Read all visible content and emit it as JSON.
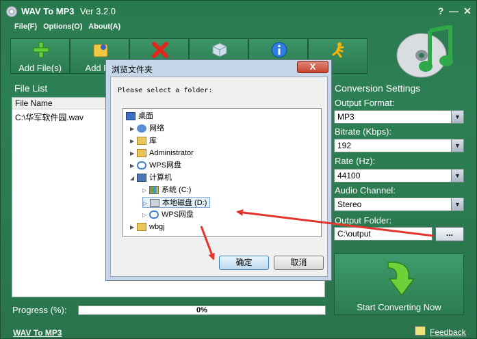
{
  "window": {
    "title": "WAV To MP3",
    "version": "Ver 3.2.0",
    "help_btn": "?",
    "min_btn": "—",
    "close_btn": "✕"
  },
  "menu": [
    "File(F)",
    "Options(O)",
    "About(A)"
  ],
  "toolbar": {
    "add_files": "Add File(s)",
    "add_folder": "Add Fo",
    "exit": "Exit"
  },
  "file_list": {
    "title": "File List",
    "header": "File Name",
    "rows": [
      "C:\\华军软件园.wav"
    ]
  },
  "progress": {
    "label": "Progress (%):",
    "value_text": "0%",
    "value": 0
  },
  "footer": {
    "link": "WAV To MP3",
    "feedback": "Feedback"
  },
  "settings": {
    "title": "Conversion Settings",
    "output_format_label": "Output Format:",
    "output_format_value": "MP3",
    "bitrate_label": "Bitrate (Kbps):",
    "bitrate_value": "192",
    "rate_label": "Rate (Hz):",
    "rate_value": "44100",
    "channel_label": "Audio Channel:",
    "channel_value": "Stereo",
    "folder_label": "Output Folder:",
    "folder_value": "C:\\output",
    "browse_label": "...",
    "start_label": "Start Converting Now"
  },
  "dialog": {
    "title": "浏览文件夹",
    "close": "X",
    "prompt": "Please select a folder:",
    "tree": [
      {
        "label": "桌面",
        "icon": "desktop-icon"
      },
      {
        "label": "网络",
        "icon": "network-icon"
      },
      {
        "label": "库",
        "icon": "library-icon"
      },
      {
        "label": "Administrator",
        "icon": "user-folder-icon"
      },
      {
        "label": "WPS网盘",
        "icon": "cloud-icon"
      },
      {
        "label": "计算机",
        "icon": "computer-icon"
      },
      {
        "label": "系统 (C:)",
        "icon": "system-drive-icon"
      },
      {
        "label": "本地磁盘 (D:)",
        "icon": "local-drive-icon"
      },
      {
        "label": "WPS网盘",
        "icon": "cloud-icon"
      },
      {
        "label": "wbgj",
        "icon": "folder-icon"
      }
    ],
    "ok": "确定",
    "cancel": "取消"
  },
  "colors": {
    "app_bg": "#2d7f54",
    "annotation_arrow": "#e2342a",
    "dialog_frame": "#c6d7ea"
  }
}
